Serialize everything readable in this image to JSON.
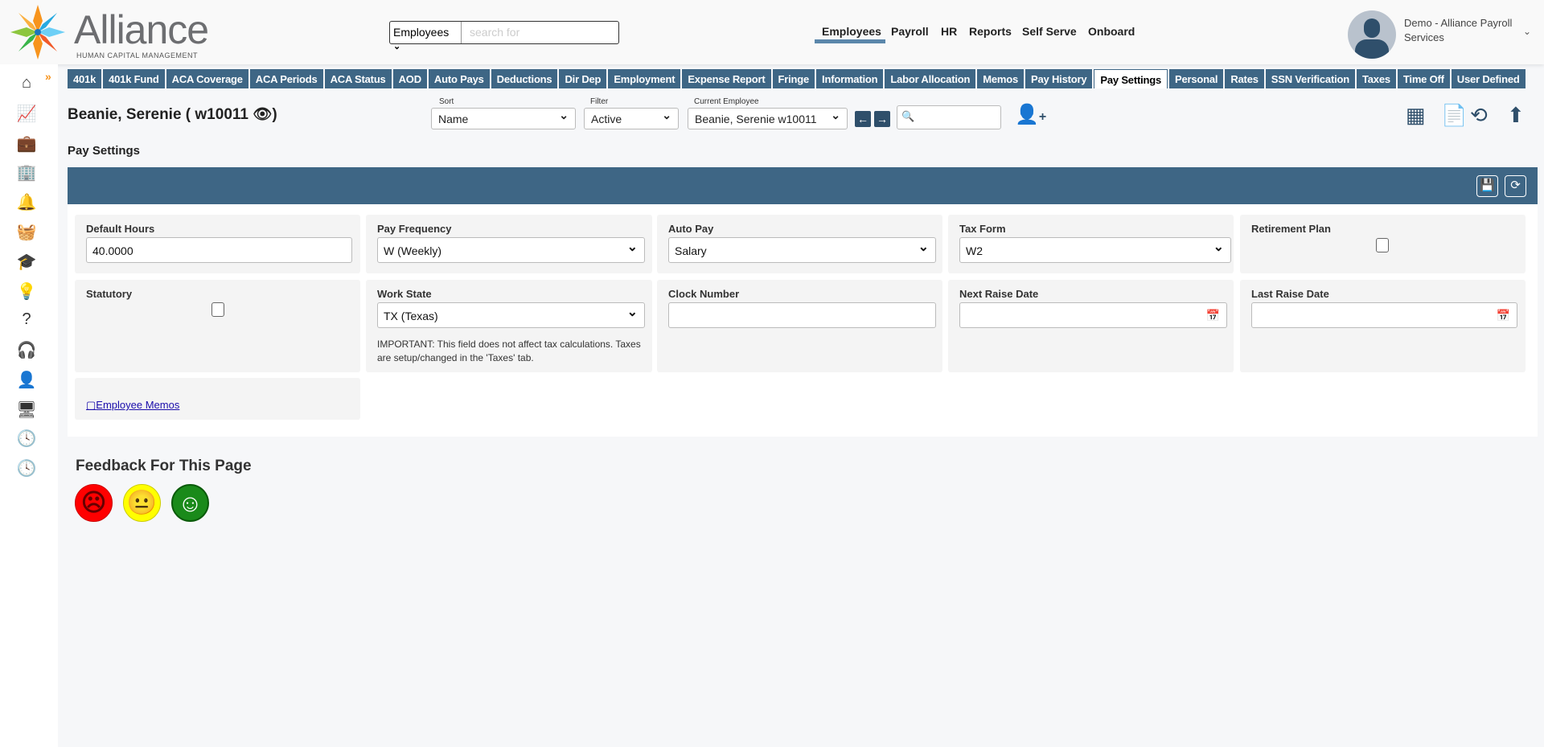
{
  "header": {
    "logo_text": "Alliance",
    "logo_subtitle": "HUMAN CAPITAL MANAGEMENT",
    "search_scope": "Employees",
    "search_placeholder": "search for",
    "nav": [
      {
        "label": "Employees",
        "active": true
      },
      {
        "label": "Payroll"
      },
      {
        "label": "HR"
      },
      {
        "label": "Reports"
      },
      {
        "label": "Self Serve"
      },
      {
        "label": "Onboard"
      }
    ],
    "user_name": "Demo - Alliance Payroll Services"
  },
  "sidebar": {
    "icons": [
      "home-icon",
      "analytics-icon",
      "briefcase-icon",
      "building-icon",
      "bell-icon",
      "basket-icon",
      "graduation-cap-icon",
      "lightbulb-icon",
      "help-icon",
      "headphones-icon",
      "person-icon",
      "monitor-icon",
      "clock-icon",
      "clock-icon"
    ]
  },
  "tabs": [
    "401k",
    "401k Fund",
    "ACA Coverage",
    "ACA Periods",
    "ACA Status",
    "AOD",
    "Auto Pays",
    "Deductions",
    "Dir Dep",
    "Employment",
    "Expense Report",
    "Fringe",
    "Information",
    "Labor Allocation",
    "Memos",
    "Pay History",
    "Pay Settings",
    "Personal",
    "Rates",
    "SSN Verification",
    "Taxes",
    "Time Off",
    "User Defined"
  ],
  "active_tab": "Pay Settings",
  "employee": {
    "name": "Beanie, Serenie ( w10011"
  },
  "toolbar": {
    "sort_label": "Sort",
    "sort_value": "Name",
    "filter_label": "Filter",
    "filter_value": "Active",
    "current_label": "Current Employee",
    "current_value": "Beanie, Serenie w10011"
  },
  "section_title": "Pay Settings",
  "form": {
    "default_hours": {
      "label": "Default Hours",
      "value": "40.0000"
    },
    "pay_frequency": {
      "label": "Pay Frequency",
      "value": "W (Weekly)"
    },
    "auto_pay": {
      "label": "Auto Pay",
      "value": "Salary"
    },
    "tax_form": {
      "label": "Tax Form",
      "value": "W2"
    },
    "retirement_plan": {
      "label": "Retirement Plan",
      "checked": false
    },
    "statutory": {
      "label": "Statutory",
      "checked": false
    },
    "work_state": {
      "label": "Work State",
      "value": "TX (Texas)",
      "note": "IMPORTANT: This field does not affect tax calculations. Taxes are setup/changed in the 'Taxes' tab."
    },
    "clock_number": {
      "label": "Clock Number",
      "value": ""
    },
    "next_raise_date": {
      "label": "Next Raise Date",
      "value": ""
    },
    "last_raise_date": {
      "label": "Last Raise Date",
      "value": ""
    },
    "memos_link": "Employee Memos"
  },
  "feedback": {
    "title": "Feedback For This Page",
    "faces": [
      {
        "icon": "sad-face-icon",
        "color": "#ff0000"
      },
      {
        "icon": "neutral-face-icon",
        "color": "#ffff00"
      },
      {
        "icon": "happy-face-icon",
        "color": "#008000"
      }
    ]
  }
}
